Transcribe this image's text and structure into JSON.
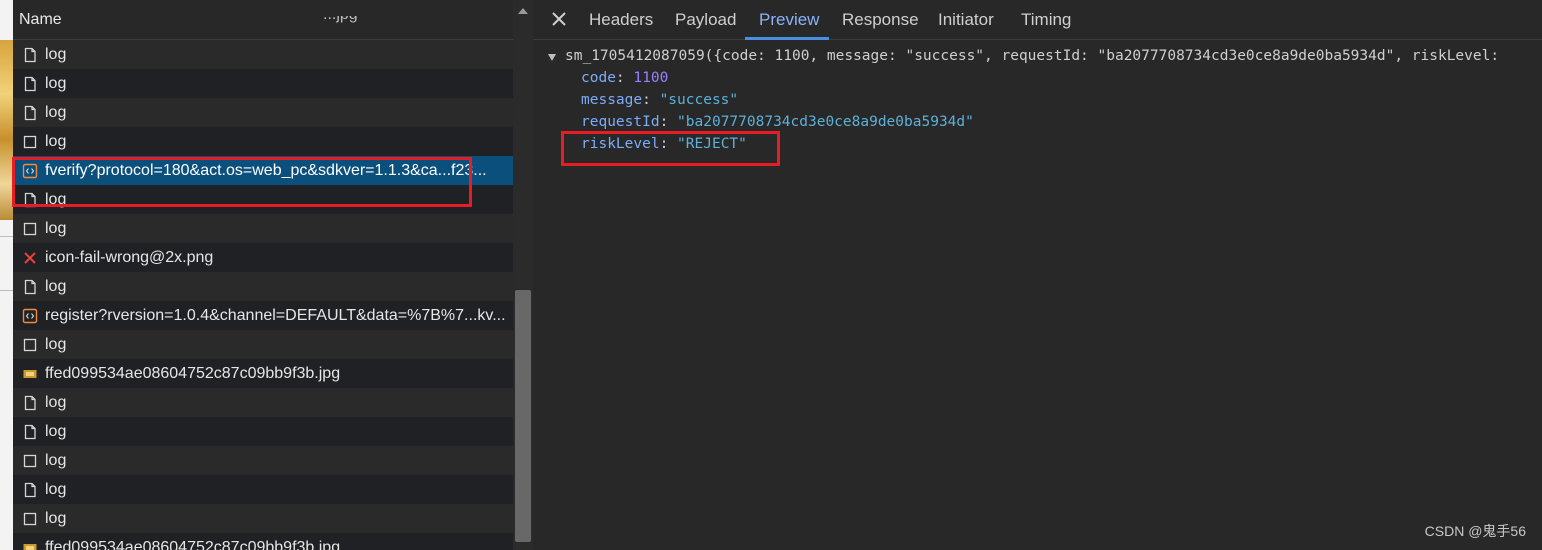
{
  "network": {
    "header": "Name",
    "cutoff_text": "...jpg",
    "rows": [
      {
        "label": "log",
        "icon": "document-icon",
        "zebra": "odd"
      },
      {
        "label": "log",
        "icon": "document-icon",
        "zebra": "even"
      },
      {
        "label": "log",
        "icon": "document-icon",
        "zebra": "odd"
      },
      {
        "label": "log",
        "icon": "checkbox-icon",
        "zebra": "even"
      },
      {
        "label": "fverify?protocol=180&act.os=web_pc&sdkver=1.1.3&ca...f23...",
        "icon": "script-icon",
        "zebra": "selected"
      },
      {
        "label": "log",
        "icon": "document-icon",
        "zebra": "even"
      },
      {
        "label": "log",
        "icon": "checkbox-icon",
        "zebra": "odd"
      },
      {
        "label": "icon-fail-wrong@2x.png",
        "icon": "error-x-icon",
        "zebra": "even"
      },
      {
        "label": "log",
        "icon": "document-icon",
        "zebra": "odd"
      },
      {
        "label": "register?rversion=1.0.4&channel=DEFAULT&data=%7B%7...kv...",
        "icon": "script-icon",
        "zebra": "even"
      },
      {
        "label": "log",
        "icon": "checkbox-icon",
        "zebra": "odd"
      },
      {
        "label": "ffed099534ae08604752c87c09bb9f3b.jpg",
        "icon": "image-icon",
        "zebra": "even"
      },
      {
        "label": "log",
        "icon": "document-icon",
        "zebra": "odd"
      },
      {
        "label": "log",
        "icon": "document-icon",
        "zebra": "even"
      },
      {
        "label": "log",
        "icon": "checkbox-icon",
        "zebra": "odd"
      },
      {
        "label": "log",
        "icon": "document-icon",
        "zebra": "even"
      },
      {
        "label": "log",
        "icon": "checkbox-icon",
        "zebra": "odd"
      },
      {
        "label": "ffed099534ae08604752c87c09bb9f3b.jpg",
        "icon": "image-icon",
        "zebra": "even"
      }
    ]
  },
  "tabs": [
    "Headers",
    "Payload",
    "Preview",
    "Response",
    "Initiator",
    "Timing"
  ],
  "active_tab": "Preview",
  "preview": {
    "summary": "sm_1705412087059({code: 1100, message: \"success\", requestId: \"ba2077708734cd3e0ce8a9de0ba5934d\", riskLevel:",
    "fields": [
      {
        "key": "code",
        "sep": ": ",
        "value": "1100",
        "type": "number"
      },
      {
        "key": "message",
        "sep": ": ",
        "value": "\"success\"",
        "type": "string"
      },
      {
        "key": "requestId",
        "sep": ": ",
        "value": "\"ba2077708734cd3e0ce8a9de0ba5934d\"",
        "type": "string"
      },
      {
        "key": "riskLevel",
        "sep": ": ",
        "value": "\"REJECT\"",
        "type": "string"
      }
    ]
  },
  "watermark": "CSDN @鬼手56",
  "colors": {
    "highlight_box": "#e81c24",
    "selected_row": "#0b4f7d",
    "active_tab": "#8ab4f8"
  }
}
